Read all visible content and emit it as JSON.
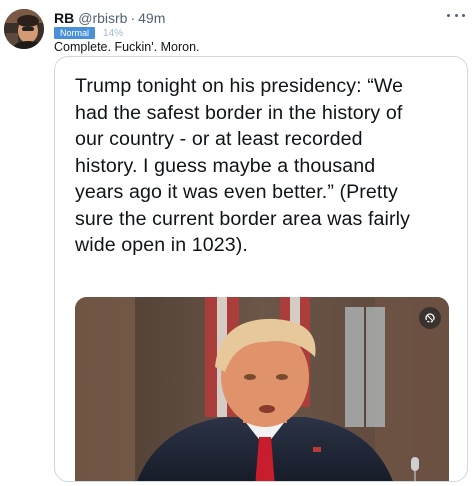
{
  "tweet": {
    "name": "RB",
    "handle": "@rbisrb",
    "separator": "·",
    "time": "49m",
    "badge": "Normal",
    "percent": "14%",
    "text": "Complete. Fuckin'. Moron."
  },
  "quoted": {
    "lines": [
      "Trump tonight on his presidency: “We",
      "had the safest border in the history of",
      "our country - or at least recorded",
      "history. I guess maybe a thousand",
      "years ago it was even better.” (Pretty",
      "sure the current border area was fairly",
      "wide open in 1023)."
    ]
  },
  "icons": {
    "more": "more-horizontal-icon",
    "media_badge": "gif-icon"
  }
}
